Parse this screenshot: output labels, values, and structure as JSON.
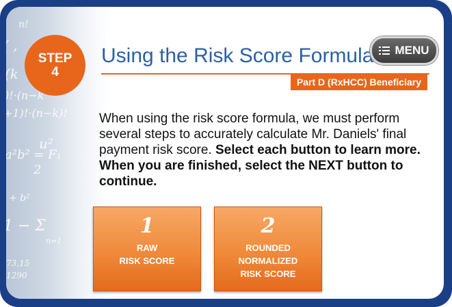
{
  "badge": {
    "line1": "STEP",
    "line2": "4"
  },
  "header": {
    "title": "Using the Risk Score Formula",
    "subtitle": "Part D (RxHCC) Beneficiary",
    "menu_label": "MENU",
    "menu_icon": "list-menu-icon"
  },
  "body": {
    "text_regular": "When using the risk score formula, we must perform several steps to accurately calculate Mr. Daniels' final payment risk score. ",
    "text_bold": "Select each button to learn more. When you are finished, select the NEXT button to continue."
  },
  "buttons": [
    {
      "number": "1",
      "line1": "RAW",
      "line2": "RISK SCORE",
      "line3": ""
    },
    {
      "number": "2",
      "line1": "ROUNDED",
      "line2": "NORMALIZED",
      "line3": "RISK SCORE"
    }
  ],
  "colors": {
    "frame": "#1a3f86",
    "accent_orange": "#e8661c",
    "title_blue": "#2b61a4"
  }
}
